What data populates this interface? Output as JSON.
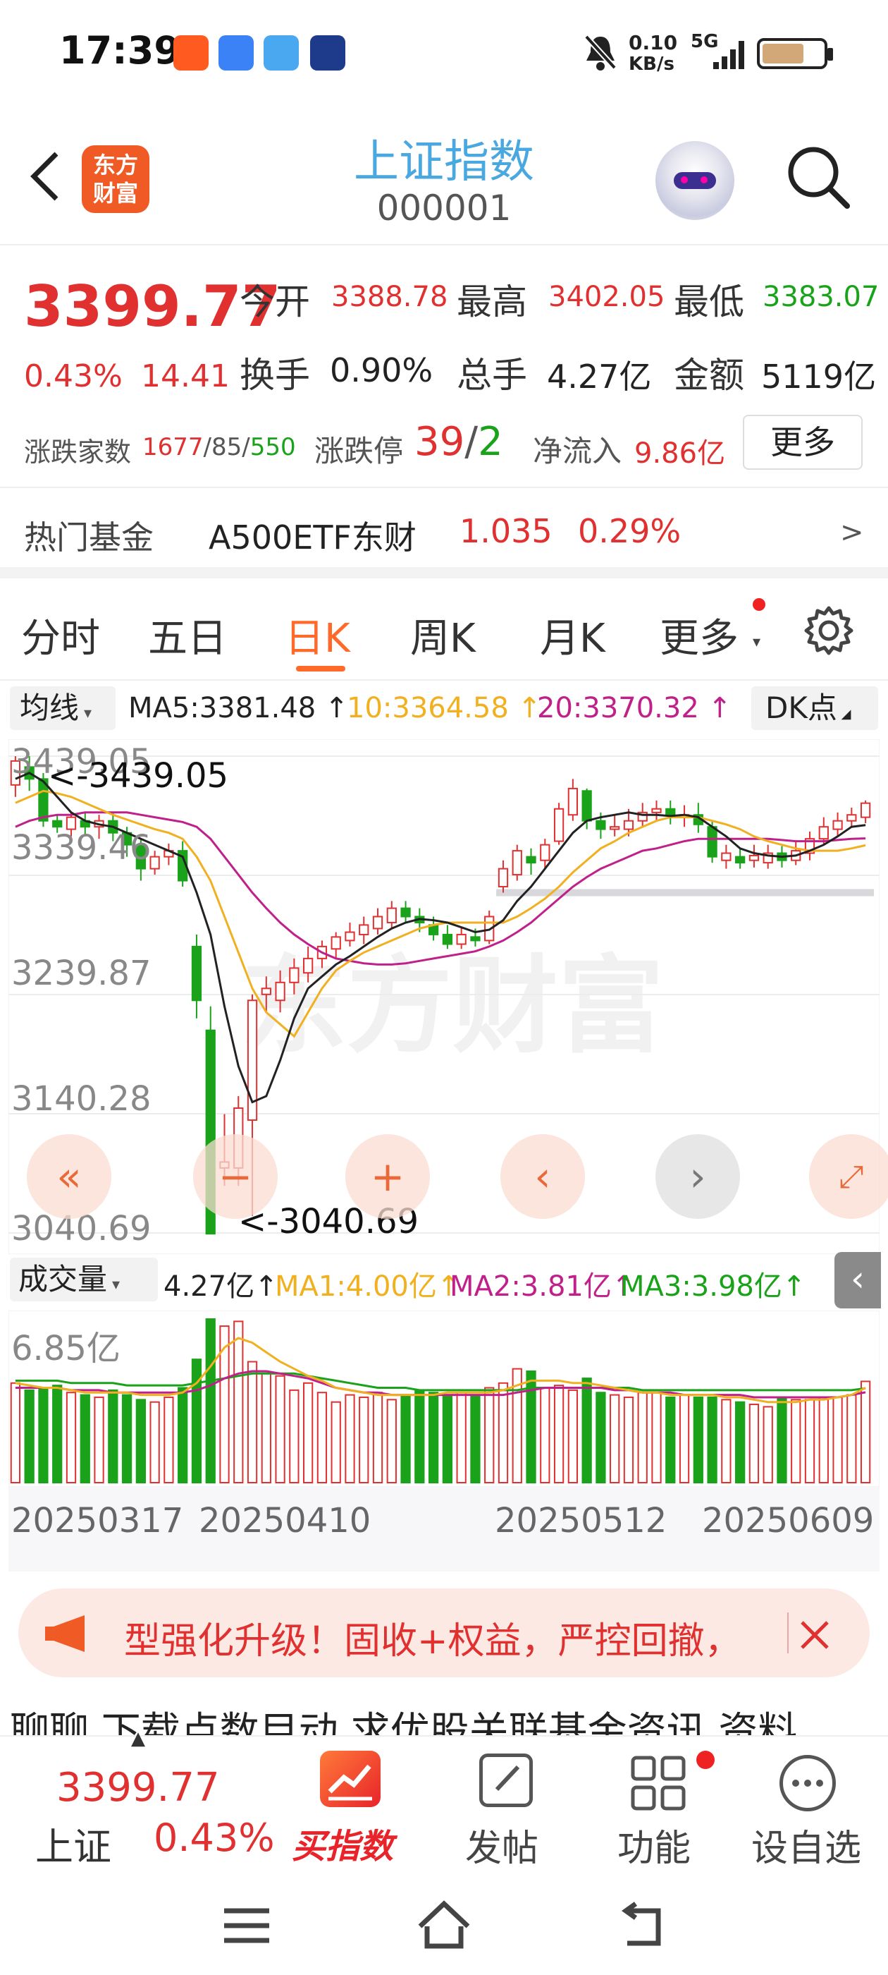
{
  "status_bar": {
    "time": "17:39",
    "net_speed": "0.10",
    "net_unit": "KB/s",
    "signal": "5G"
  },
  "nav": {
    "logo_line1": "东方",
    "logo_line2": "财富",
    "title": "上证指数",
    "code": "000001"
  },
  "quote": {
    "price": "3399.77",
    "change_pct": "0.43%",
    "change": "14.41",
    "open_label": "今开",
    "open": "3388.78",
    "high_label": "最高",
    "high": "3402.05",
    "low_label": "最低",
    "low": "3383.07",
    "turnover_label": "换手",
    "turnover": "0.90%",
    "volume_label": "总手",
    "volume": "4.27亿",
    "amount_label": "金额",
    "amount": "5119亿",
    "breadth_label": "涨跌家数",
    "breadth_up": "1677",
    "breadth_flat": "85",
    "breadth_down": "550",
    "limit_label": "涨跌停",
    "limit_up": "39",
    "limit_down": "2",
    "inflow_label": "净流入",
    "inflow": "9.86亿",
    "more_label": "更多"
  },
  "fund": {
    "label": "热门基金",
    "name": "A500ETF东财",
    "price": "1.035",
    "pct": "0.29%"
  },
  "tabs": [
    "分时",
    "五日",
    "日K",
    "周K",
    "月K",
    "更多"
  ],
  "active_tab": 2,
  "ma": {
    "select": "均线",
    "ma5": "MA5:3381.48 ↑",
    "ma10": "10:3364.58 ↑",
    "ma20": "20:3370.32 ↑",
    "dk": "DK点"
  },
  "axis": {
    "y1": "3439.05",
    "y2": "3339.46",
    "y3": "3239.87",
    "y4": "3140.28",
    "y5": "3040.69",
    "hi_marker": "<-3439.05",
    "lo_marker": "<-3040.69",
    "vol_max": "6.85亿"
  },
  "vol": {
    "select": "成交量",
    "v": "4.27亿↑",
    "ma1": "MA1:4.00亿↑",
    "ma2": "MA2:3.81亿↑",
    "ma3": "MA3:3.98亿↑"
  },
  "dates": [
    "20250317",
    "20250410",
    "20250512",
    "20250609"
  ],
  "promo": {
    "text": "型强化升级！固收+权益，严控回撤，"
  },
  "ticker_text": "聊聊 下载点数目动 求优股关联基金资讯 资料",
  "bottom": {
    "price": "3399.77",
    "name": "上证",
    "pct": "0.43%",
    "buy": "买指数",
    "post": "发帖",
    "func": "功能",
    "watch": "设自选"
  },
  "watermark": "东方财富",
  "colors": {
    "up": "#e03030",
    "down": "#1aa31a",
    "accent": "#ff6a2a",
    "title": "#4aa8e0"
  },
  "chart_data": {
    "type": "candlestick",
    "ylim": [
      3040.69,
      3439.05
    ],
    "candles": [
      [
        3415,
        3435,
        3405,
        3439
      ],
      [
        3430,
        3420,
        3410,
        3439
      ],
      [
        3420,
        3385,
        3380,
        3425
      ],
      [
        3385,
        3380,
        3375,
        3390
      ],
      [
        3378,
        3388,
        3372,
        3392
      ],
      [
        3385,
        3380,
        3372,
        3392
      ],
      [
        3380,
        3385,
        3370,
        3390
      ],
      [
        3385,
        3375,
        3368,
        3392
      ],
      [
        3375,
        3365,
        3355,
        3380
      ],
      [
        3365,
        3345,
        3335,
        3370
      ],
      [
        3345,
        3355,
        3340,
        3360
      ],
      [
        3355,
        3360,
        3348,
        3366
      ],
      [
        3360,
        3335,
        3330,
        3368
      ],
      [
        3280,
        3235,
        3220,
        3290
      ],
      [
        3210,
        3040,
        3040,
        3230
      ],
      [
        3095,
        3100,
        3080,
        3140
      ],
      [
        3095,
        3145,
        3080,
        3155
      ],
      [
        3135,
        3235,
        3055,
        3240
      ],
      [
        3240,
        3245,
        3225,
        3255
      ],
      [
        3235,
        3250,
        3225,
        3260
      ],
      [
        3250,
        3262,
        3240,
        3270
      ],
      [
        3258,
        3270,
        3250,
        3280
      ],
      [
        3270,
        3280,
        3262,
        3285
      ],
      [
        3278,
        3288,
        3270,
        3292
      ],
      [
        3285,
        3292,
        3280,
        3300
      ],
      [
        3290,
        3298,
        3282,
        3305
      ],
      [
        3295,
        3305,
        3290,
        3312
      ],
      [
        3300,
        3312,
        3295,
        3318
      ],
      [
        3312,
        3305,
        3300,
        3318
      ],
      [
        3305,
        3300,
        3292,
        3312
      ],
      [
        3298,
        3290,
        3285,
        3305
      ],
      [
        3290,
        3282,
        3278,
        3298
      ],
      [
        3282,
        3290,
        3278,
        3296
      ],
      [
        3288,
        3285,
        3280,
        3295
      ],
      [
        3285,
        3305,
        3282,
        3310
      ],
      [
        3330,
        3345,
        3325,
        3352
      ],
      [
        3340,
        3360,
        3335,
        3365
      ],
      [
        3355,
        3350,
        3340,
        3362
      ],
      [
        3352,
        3365,
        3345,
        3370
      ],
      [
        3368,
        3395,
        3365,
        3400
      ],
      [
        3390,
        3412,
        3385,
        3420
      ],
      [
        3410,
        3385,
        3378,
        3412
      ],
      [
        3385,
        3378,
        3370,
        3392
      ],
      [
        3378,
        3380,
        3372,
        3390
      ],
      [
        3378,
        3385,
        3372,
        3395
      ],
      [
        3385,
        3392,
        3380,
        3400
      ],
      [
        3392,
        3395,
        3385,
        3402
      ],
      [
        3395,
        3390,
        3382,
        3402
      ],
      [
        3388,
        3390,
        3380,
        3398
      ],
      [
        3390,
        3382,
        3375,
        3400
      ],
      [
        3380,
        3355,
        3350,
        3385
      ],
      [
        3352,
        3358,
        3345,
        3365
      ],
      [
        3355,
        3350,
        3345,
        3362
      ],
      [
        3352,
        3356,
        3346,
        3365
      ],
      [
        3350,
        3358,
        3345,
        3365
      ],
      [
        3358,
        3352,
        3346,
        3364
      ],
      [
        3352,
        3360,
        3348,
        3368
      ],
      [
        3358,
        3370,
        3352,
        3376
      ],
      [
        3370,
        3380,
        3365,
        3388
      ],
      [
        3378,
        3385,
        3372,
        3392
      ],
      [
        3385,
        3390,
        3380,
        3396
      ],
      [
        3388,
        3399.77,
        3383.07,
        3402.05
      ]
    ],
    "ma5": [
      3420,
      3425,
      3418,
      3405,
      3392,
      3385,
      3382,
      3380,
      3375,
      3370,
      3365,
      3360,
      3355,
      3325,
      3290,
      3230,
      3180,
      3150,
      3155,
      3185,
      3220,
      3245,
      3255,
      3265,
      3272,
      3280,
      3288,
      3295,
      3300,
      3303,
      3302,
      3300,
      3296,
      3292,
      3294,
      3302,
      3318,
      3330,
      3345,
      3360,
      3375,
      3385,
      3388,
      3390,
      3392,
      3390,
      3390,
      3389,
      3390,
      3388,
      3380,
      3372,
      3362,
      3358,
      3356,
      3355,
      3356,
      3360,
      3365,
      3372,
      3380,
      3381.48
    ],
    "ma10": [
      3400,
      3405,
      3410,
      3408,
      3405,
      3400,
      3395,
      3390,
      3386,
      3382,
      3378,
      3375,
      3370,
      3355,
      3335,
      3305,
      3275,
      3245,
      3225,
      3215,
      3205,
      3225,
      3245,
      3260,
      3268,
      3275,
      3280,
      3285,
      3290,
      3295,
      3298,
      3300,
      3300,
      3300,
      3300,
      3300,
      3305,
      3312,
      3320,
      3330,
      3342,
      3352,
      3362,
      3368,
      3375,
      3380,
      3385,
      3388,
      3388,
      3388,
      3385,
      3382,
      3378,
      3372,
      3368,
      3365,
      3362,
      3360,
      3360,
      3360,
      3362,
      3364.58
    ],
    "ma20": [
      3380,
      3385,
      3388,
      3390,
      3390,
      3392,
      3392,
      3392,
      3392,
      3390,
      3388,
      3386,
      3384,
      3380,
      3370,
      3355,
      3340,
      3325,
      3312,
      3300,
      3290,
      3282,
      3275,
      3270,
      3268,
      3266,
      3265,
      3265,
      3266,
      3268,
      3270,
      3272,
      3274,
      3276,
      3280,
      3285,
      3292,
      3300,
      3310,
      3320,
      3330,
      3338,
      3345,
      3350,
      3355,
      3360,
      3362,
      3365,
      3368,
      3370,
      3370,
      3370,
      3370,
      3370,
      3370,
      3369,
      3368,
      3368,
      3368,
      3369,
      3370,
      3370.32
    ],
    "volume": [
      4.2,
      3.9,
      4.0,
      4.1,
      3.8,
      3.7,
      3.6,
      3.9,
      3.7,
      3.5,
      3.4,
      3.6,
      4.0,
      5.2,
      6.9,
      6.6,
      6.8,
      5.1,
      4.6,
      4.5,
      3.9,
      4.2,
      3.8,
      3.4,
      3.7,
      3.6,
      3.8,
      3.5,
      3.7,
      3.9,
      3.8,
      3.7,
      3.8,
      3.7,
      4.0,
      4.2,
      4.8,
      4.7,
      4.0,
      4.1,
      3.9,
      4.4,
      3.8,
      3.7,
      3.6,
      3.8,
      3.8,
      3.6,
      3.7,
      3.6,
      3.6,
      3.5,
      3.4,
      3.3,
      3.2,
      3.6,
      3.5,
      3.5,
      3.6,
      3.6,
      3.7,
      4.27
    ],
    "vol_ma1": [
      4.2,
      4.1,
      4.0,
      4.0,
      3.9,
      3.8,
      3.8,
      3.8,
      3.8,
      3.7,
      3.7,
      3.7,
      3.8,
      4.2,
      4.9,
      5.7,
      6.1,
      5.9,
      5.5,
      5.1,
      4.8,
      4.5,
      4.3,
      4.0,
      3.9,
      3.8,
      3.7,
      3.7,
      3.7,
      3.7,
      3.7,
      3.8,
      3.8,
      3.8,
      3.8,
      3.9,
      4.1,
      4.3,
      4.3,
      4.3,
      4.2,
      4.2,
      4.1,
      4.0,
      3.9,
      3.8,
      3.8,
      3.7,
      3.7,
      3.7,
      3.7,
      3.6,
      3.6,
      3.5,
      3.4,
      3.4,
      3.4,
      3.5,
      3.5,
      3.6,
      3.7,
      4.0
    ],
    "vol_ma2": [
      4.0,
      4.0,
      4.0,
      4.0,
      3.9,
      3.9,
      3.9,
      3.8,
      3.8,
      3.8,
      3.8,
      3.8,
      3.8,
      3.9,
      4.1,
      4.4,
      4.6,
      4.7,
      4.7,
      4.6,
      4.5,
      4.4,
      4.2,
      4.0,
      3.9,
      3.8,
      3.8,
      3.7,
      3.7,
      3.7,
      3.7,
      3.7,
      3.7,
      3.7,
      3.7,
      3.7,
      3.8,
      3.9,
      4.0,
      4.0,
      4.0,
      4.0,
      4.0,
      3.9,
      3.9,
      3.8,
      3.8,
      3.8,
      3.7,
      3.7,
      3.7,
      3.7,
      3.7,
      3.6,
      3.6,
      3.6,
      3.6,
      3.6,
      3.6,
      3.6,
      3.7,
      3.81
    ],
    "vol_ma3": [
      4.3,
      4.3,
      4.3,
      4.3,
      4.2,
      4.2,
      4.2,
      4.2,
      4.1,
      4.1,
      4.1,
      4.1,
      4.1,
      4.2,
      4.3,
      4.4,
      4.5,
      4.6,
      4.6,
      4.6,
      4.6,
      4.5,
      4.4,
      4.3,
      4.2,
      4.1,
      4.0,
      4.0,
      4.0,
      3.9,
      3.9,
      3.9,
      3.9,
      3.9,
      3.9,
      3.9,
      3.9,
      4.0,
      4.0,
      4.0,
      4.0,
      4.0,
      4.0,
      4.0,
      4.0,
      3.9,
      3.9,
      3.9,
      3.9,
      3.9,
      3.9,
      3.9,
      3.9,
      3.9,
      3.9,
      3.9,
      3.9,
      3.9,
      3.9,
      3.9,
      3.9,
      3.98
    ]
  }
}
